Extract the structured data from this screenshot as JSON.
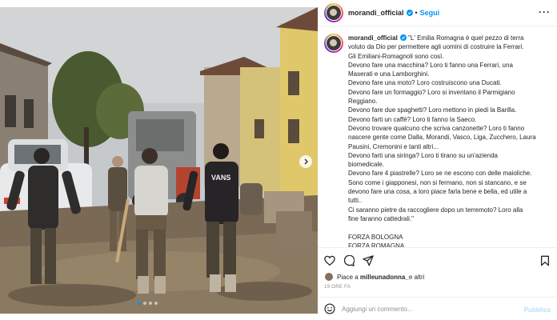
{
  "post": {
    "username": "morandi_official",
    "follow_label": "Segui",
    "separator": "•",
    "caption_lines": [
      "\"L' Emilia Romagna è quel pezzo di terra",
      "voluto da Dio per permettere agli uomini di costruire la Ferrari.",
      "Gli Emiliani-Romagnoli sono così.",
      "Devono fare una macchina? Loro ti fanno una Ferrari, una",
      "Maserati e una Lamborghini.",
      "Devono fare una moto? Loro costruiscono una Ducati.",
      "Devono fare un formaggio? Loro si inventano il Parmigiano",
      "Reggiano.",
      "Devono fare due spaghetti? Loro mettono in piedi la Barilla.",
      "Devono farti un caffè? Loro ti fanno la Saeco.",
      "Devono trovare qualcuno che scriva canzonette? Loro ti fanno",
      "nascere gente come Dalla, Morandi, Vasco, Liga, Zucchero, Laura",
      "Pausini, Cremonini e tanti altri...",
      "Devono farti una siringa? Loro ti tirano su un'azienda",
      "biomedicale.",
      "Devono fare 4 piastrelle? Loro se ne escono con delle maioliche.",
      "Sono come i giapponesi, non si fermano, non si stancano, e se",
      "devono fare una cosa, a loro piace farla bene e bella, ed utile a",
      "tutti..",
      "Ci saranno pietre da raccogliere dopo un terremoto? Loro alla",
      "fine faranno cattedrali.\"",
      "",
      "FORZA BOLOGNA",
      "FORZA ROMAGNA"
    ],
    "likes_prefix": "Piace a ",
    "likes_user": "milleunadonna_",
    "likes_suffix": " e altri",
    "time": "19 ORE FA"
  },
  "comment": {
    "placeholder": "Aggiungi un commento...",
    "publish_label": "Pubblica"
  },
  "photo": {
    "tshirt_text": "VANS",
    "carousel_dots": 4,
    "active_dot": 0
  },
  "icons": {
    "more": "more-options-icon",
    "verified": "verified-badge-icon",
    "like": "heart-icon",
    "comment": "comment-icon",
    "share": "send-icon",
    "save": "bookmark-icon",
    "emoji": "emoji-icon",
    "next": "chevron-right-icon"
  },
  "colors": {
    "accent": "#0095f6",
    "mud": "#7a6a55",
    "sky": "#c9ccce",
    "foliage": "#4a5a30"
  }
}
